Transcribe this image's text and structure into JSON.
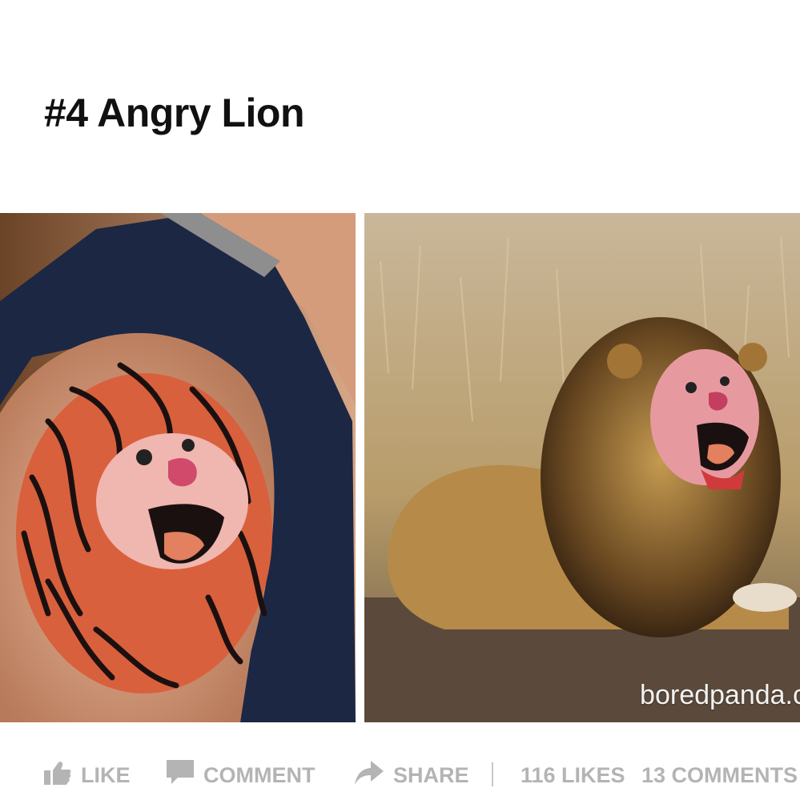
{
  "post": {
    "title": "#4 Angry Lion",
    "watermark": "boredpanda.c"
  },
  "images": [
    {
      "name": "tattoo-photo",
      "depicts": "lion-head-tattoo-on-shoulder"
    },
    {
      "name": "lion-photo",
      "depicts": "lion-with-tattoo-face-overlay"
    }
  ],
  "actions": {
    "like": {
      "label": "LIKE",
      "icon": "thumbs-up-icon"
    },
    "comment": {
      "label": "COMMENT",
      "icon": "speech-bubble-icon"
    },
    "share": {
      "label": "SHARE",
      "icon": "share-arrow-icon"
    }
  },
  "stats": {
    "likes": "116 LIKES",
    "comments": "13 COMMENTS"
  },
  "colors": {
    "title": "#111111",
    "action_text": "#b4b4b4",
    "background": "#ffffff"
  }
}
